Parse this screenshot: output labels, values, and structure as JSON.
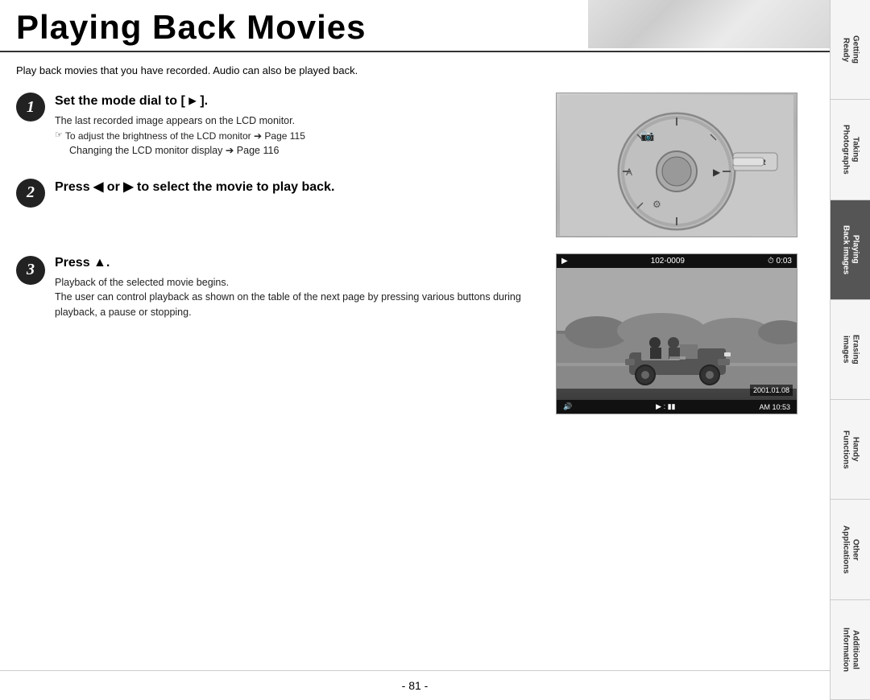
{
  "page": {
    "title": "Playing Back Movies",
    "intro": "Play back movies that you have recorded. Audio can also be played back.",
    "page_number": "- 81 -"
  },
  "steps": [
    {
      "number": "1",
      "title_prefix": "Set the mode dial to [ ",
      "title_icon": "▶",
      "title_suffix": " ].",
      "descriptions": [
        "The last recorded image appears on the LCD monitor.",
        "☞To adjust the brightness of the LCD monitor ➔ Page 115",
        "   Changing the LCD monitor display ➔ Page 116"
      ]
    },
    {
      "number": "2",
      "title": "Press ◀ or ▶ to select the movie to play back.",
      "descriptions": []
    },
    {
      "number": "3",
      "title": "Press ▲.",
      "descriptions": [
        "Playback of the selected movie begins.",
        "The user can control playback as shown on the table of the next page by pressing various buttons during playback, a pause or stopping."
      ]
    }
  ],
  "movie_display": {
    "file_id": "102-0009",
    "time": "0:03",
    "date": "2001.01.08",
    "time_display": "AM 10:53"
  },
  "power_label": "POWER",
  "sidebar": {
    "tabs": [
      {
        "label": "Getting\nReady",
        "active": false
      },
      {
        "label": "Taking\nPhotographs",
        "active": false
      },
      {
        "label": "Playing\nBack images",
        "active": true
      },
      {
        "label": "Erasing\nimages",
        "active": false
      },
      {
        "label": "Handy\nFunctions",
        "active": false
      },
      {
        "label": "Other\nApplications",
        "active": false
      },
      {
        "label": "Additional\nInformation",
        "active": false
      }
    ]
  }
}
